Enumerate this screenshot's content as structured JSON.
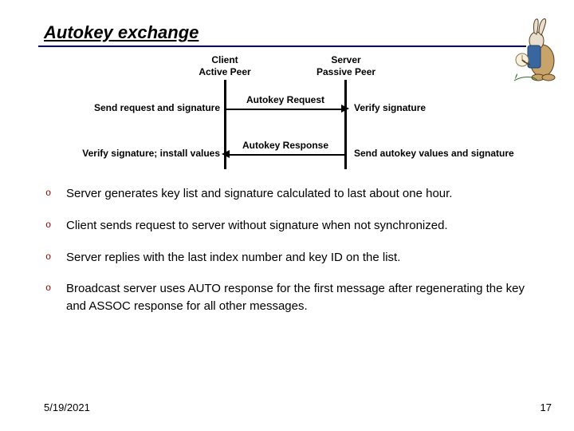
{
  "title": "Autokey exchange",
  "client_header_line1": "Client",
  "client_header_line2": "Active Peer",
  "server_header_line1": "Server",
  "server_header_line2": "Passive Peer",
  "msg_request": "Autokey Request",
  "msg_response": "Autokey Response",
  "left1": "Send request and signature",
  "left2": "Verify signature; install values",
  "right1": "Verify signature",
  "right2": "Send autokey values and signature",
  "bullets": [
    "Server generates key list and signature calculated to last about one hour.",
    "Client sends request to server without signature when not synchronized.",
    "Server replies with the last index number and key ID on the list.",
    "Broadcast server uses AUTO response for the first message after regenerating the key and ASSOC response for all other messages."
  ],
  "date": "5/19/2021",
  "page": "17"
}
